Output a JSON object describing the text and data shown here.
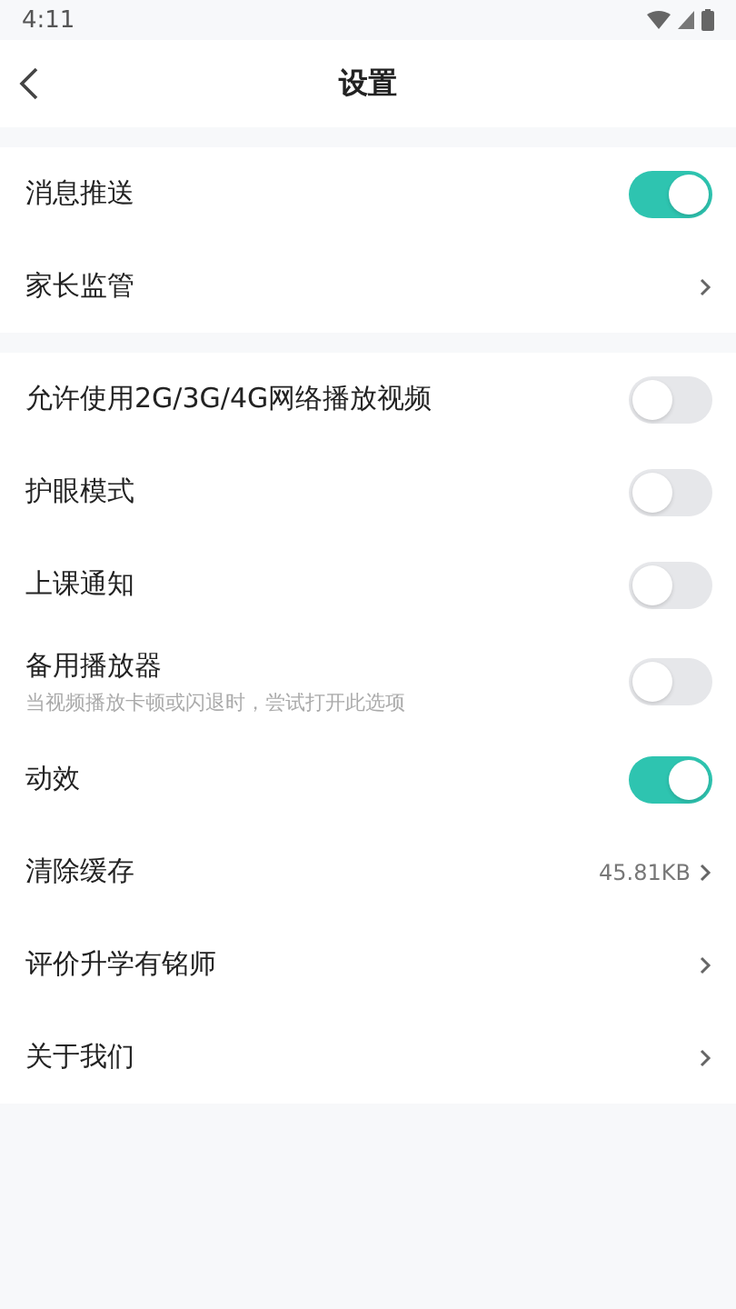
{
  "status_bar": {
    "time": "4:11"
  },
  "header": {
    "title": "设置"
  },
  "sections": [
    {
      "rows": [
        {
          "kind": "toggle",
          "label": "消息推送",
          "on": true
        },
        {
          "kind": "link",
          "label": "家长监管"
        }
      ]
    },
    {
      "rows": [
        {
          "kind": "toggle",
          "label": "允许使用2G/3G/4G网络播放视频",
          "on": false
        },
        {
          "kind": "toggle",
          "label": "护眼模式",
          "on": false
        },
        {
          "kind": "toggle",
          "label": "上课通知",
          "on": false
        },
        {
          "kind": "toggle",
          "label": "备用播放器",
          "hint": "当视频播放卡顿或闪退时，尝试打开此选项",
          "on": false
        },
        {
          "kind": "toggle",
          "label": "动效",
          "on": true
        },
        {
          "kind": "link",
          "label": "清除缓存",
          "value": "45.81KB"
        },
        {
          "kind": "link",
          "label": "评价升学有铭师"
        },
        {
          "kind": "link",
          "label": "关于我们"
        }
      ]
    }
  ]
}
